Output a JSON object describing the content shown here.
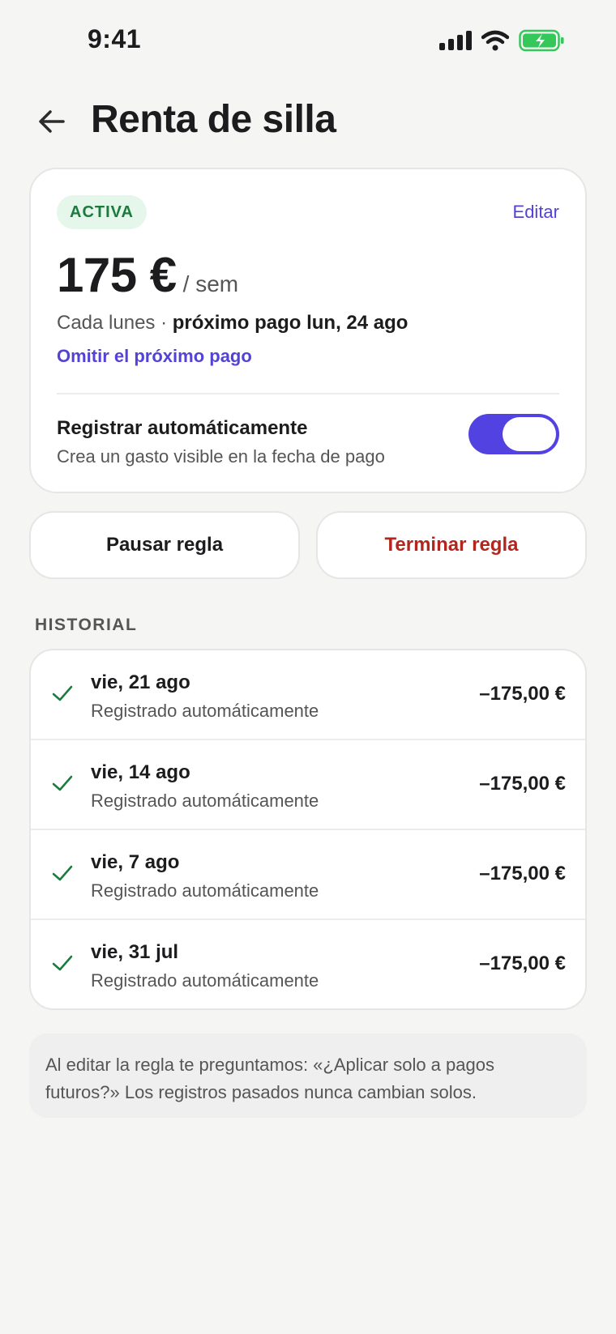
{
  "status_bar": {
    "time": "9:41"
  },
  "header": {
    "title": "Renta de silla"
  },
  "rule_card": {
    "status_badge": "ACTIVA",
    "edit_label": "Editar",
    "amount": "175 €",
    "period": "/ sem",
    "schedule_prefix": "Cada lunes · ",
    "schedule_next": "próximo pago lun, 24 ago",
    "skip_label": "Omitir el próximo pago",
    "auto_register": {
      "title": "Registrar automáticamente",
      "subtitle": "Crea un gasto visible en la fecha de pago",
      "enabled": true
    }
  },
  "actions": {
    "pause_label": "Pausar regla",
    "end_label": "Terminar regla"
  },
  "history": {
    "label": "HISTORIAL",
    "items": [
      {
        "date": "vie, 21 ago",
        "note": "Registrado automáticamente",
        "amount": "–175,00 €"
      },
      {
        "date": "vie, 14 ago",
        "note": "Registrado automáticamente",
        "amount": "–175,00 €"
      },
      {
        "date": "vie, 7 ago",
        "note": "Registrado automáticamente",
        "amount": "–175,00 €"
      },
      {
        "date": "vie, 31 jul",
        "note": "Registrado automáticamente",
        "amount": "–175,00 €"
      }
    ]
  },
  "footer_note": "Al editar la regla te preguntamos: «¿Aplicar solo a pagos futuros?» Los registros pasados nunca cambian solos.",
  "colors": {
    "accent": "#5242e2",
    "danger": "#b3261e",
    "success": "#1b7a3d",
    "badge_bg": "#e5f6ea"
  },
  "icons": {
    "back": "arrow-left-icon",
    "check": "checkmark-icon",
    "signal": "cellular-signal-icon",
    "wifi": "wifi-icon",
    "battery": "battery-charging-icon"
  }
}
